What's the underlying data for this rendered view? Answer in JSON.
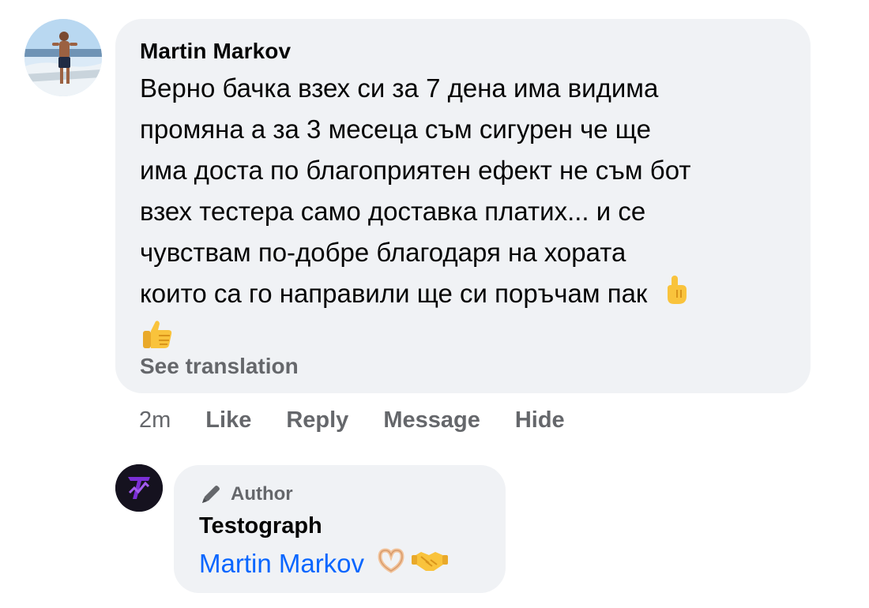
{
  "comment": {
    "author": "Martin Markov",
    "lines": [
      "Верно бачка взех си за 7 дена има видима",
      "промяна а за 3 месеца съм сигурен че ще",
      "има доста по благоприятен ефект не съм бот",
      "взех тестера само доставка платих... и се",
      "чувствам по-добре благодаря на хората",
      "които са го направили ще си поръчам пак"
    ],
    "see_translation": "See translation",
    "icons": [
      "pointing-hand-icon",
      "thumbs-up-icon"
    ]
  },
  "actions": {
    "time": "2m",
    "like": "Like",
    "reply": "Reply",
    "message": "Message",
    "hide": "Hide"
  },
  "reply": {
    "badge": "Author",
    "author": "Testograph",
    "mention": "Martin Markov",
    "icons": [
      "heart-hands-icon",
      "handshake-icon"
    ]
  },
  "colors": {
    "bubble": "#f0f2f5",
    "secondary_text": "#65676b",
    "link": "#0866ff",
    "text": "#050505"
  }
}
